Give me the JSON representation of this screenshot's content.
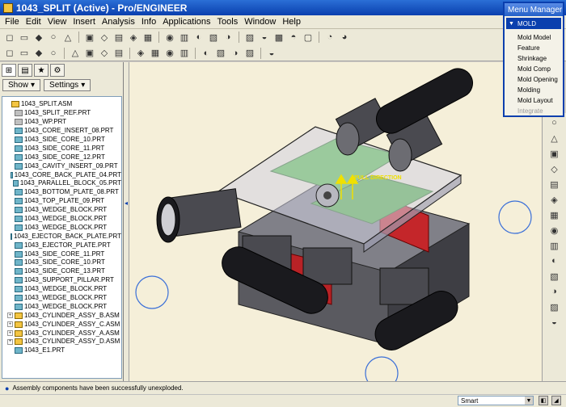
{
  "window": {
    "title": "1043_SPLIT (Active) - Pro/ENGINEER"
  },
  "menubar": [
    "File",
    "Edit",
    "View",
    "Insert",
    "Analysis",
    "Info",
    "Applications",
    "Tools",
    "Window",
    "Help"
  ],
  "panel": {
    "show_label": "Show",
    "settings_label": "Settings"
  },
  "tree": [
    {
      "label": "1043_SPLIT.ASM",
      "type": "asm",
      "indent": 0,
      "expander": ""
    },
    {
      "label": "1043_SPLIT_REF.PRT",
      "type": "ref",
      "indent": 1,
      "expander": ""
    },
    {
      "label": "1043_WP.PRT",
      "type": "ref",
      "indent": 1,
      "expander": ""
    },
    {
      "label": "1043_CORE_INSERT_08.PRT",
      "type": "prt",
      "indent": 1,
      "expander": ""
    },
    {
      "label": "1043_SIDE_CORE_10.PRT",
      "type": "prt",
      "indent": 1,
      "expander": ""
    },
    {
      "label": "1043_SIDE_CORE_11.PRT",
      "type": "prt",
      "indent": 1,
      "expander": ""
    },
    {
      "label": "1043_SIDE_CORE_12.PRT",
      "type": "prt",
      "indent": 1,
      "expander": ""
    },
    {
      "label": "1043_CAVITY_INSERT_09.PRT",
      "type": "prt",
      "indent": 1,
      "expander": ""
    },
    {
      "label": "1043_CORE_BACK_PLATE_04.PRT",
      "type": "prt",
      "indent": 1,
      "expander": ""
    },
    {
      "label": "1043_PARALLEL_BLOCK_05.PRT",
      "type": "prt",
      "indent": 1,
      "expander": ""
    },
    {
      "label": "1043_BOTTOM_PLATE_08.PRT",
      "type": "prt",
      "indent": 1,
      "expander": ""
    },
    {
      "label": "1043_TOP_PLATE_09.PRT",
      "type": "prt",
      "indent": 1,
      "expander": ""
    },
    {
      "label": "1043_WEDGE_BLOCK.PRT",
      "type": "prt",
      "indent": 1,
      "expander": ""
    },
    {
      "label": "1043_WEDGE_BLOCK.PRT",
      "type": "prt",
      "indent": 1,
      "expander": ""
    },
    {
      "label": "1043_WEDGE_BLOCK.PRT",
      "type": "prt",
      "indent": 1,
      "expander": ""
    },
    {
      "label": "1043_EJECTOR_BACK_PLATE.PRT",
      "type": "prt",
      "indent": 1,
      "expander": ""
    },
    {
      "label": "1043_EJECTOR_PLATE.PRT",
      "type": "prt",
      "indent": 1,
      "expander": ""
    },
    {
      "label": "1043_SIDE_CORE_11.PRT",
      "type": "prt",
      "indent": 1,
      "expander": ""
    },
    {
      "label": "1043_SIDE_CORE_10.PRT",
      "type": "prt",
      "indent": 1,
      "expander": ""
    },
    {
      "label": "1043_SIDE_CORE_13.PRT",
      "type": "prt",
      "indent": 1,
      "expander": ""
    },
    {
      "label": "1043_SUPPORT_PILLAR.PRT",
      "type": "prt",
      "indent": 1,
      "expander": ""
    },
    {
      "label": "1043_WEDGE_BLOCK.PRT",
      "type": "prt",
      "indent": 1,
      "expander": ""
    },
    {
      "label": "1043_WEDGE_BLOCK.PRT",
      "type": "prt",
      "indent": 1,
      "expander": ""
    },
    {
      "label": "1043_WEDGE_BLOCK.PRT",
      "type": "prt",
      "indent": 1,
      "expander": ""
    },
    {
      "label": "1043_CYLINDER_ASSY_B.ASM",
      "type": "asm",
      "indent": 1,
      "expander": "+"
    },
    {
      "label": "1043_CYLINDER_ASSY_C.ASM",
      "type": "asm",
      "indent": 1,
      "expander": "+"
    },
    {
      "label": "1043_CYLINDER_ASSY_A.ASM",
      "type": "asm",
      "indent": 1,
      "expander": "+"
    },
    {
      "label": "1043_CYLINDER_ASSY_D.ASM",
      "type": "asm",
      "indent": 1,
      "expander": "+"
    },
    {
      "label": "1043_E1.PRT",
      "type": "prt",
      "indent": 1,
      "expander": ""
    }
  ],
  "viewport": {
    "annotation": "PULL DIRECTION"
  },
  "menu_manager": {
    "title": "Menu Manager",
    "header": "MOLD",
    "items": [
      {
        "label": "Mold Model",
        "enabled": true
      },
      {
        "label": "Feature",
        "enabled": true
      },
      {
        "label": "Shrinkage",
        "enabled": true
      },
      {
        "label": "Mold Comp",
        "enabled": true
      },
      {
        "label": "Mold Opening",
        "enabled": true
      },
      {
        "label": "Molding",
        "enabled": true
      },
      {
        "label": "Mold Layout",
        "enabled": true
      },
      {
        "label": "Integrate",
        "enabled": false
      }
    ]
  },
  "status": {
    "message": "Assembly components have been successfully unexploded."
  },
  "filter": {
    "value": "Smart"
  },
  "icons": {
    "toolbar1": [
      "new-icon",
      "open-icon",
      "save-icon",
      "print-icon",
      "email-icon",
      "undo-icon",
      "redo-icon",
      "cut-icon",
      "copy-icon",
      "paste-icon",
      "regenerate-icon",
      "find-icon",
      "select-box-icon",
      "repaint-icon",
      "spin-center-icon",
      "zoom-in-icon",
      "zoom-out-icon",
      "refit-icon",
      "reorient-icon",
      "saved-views-icon",
      "layers-icon",
      "view-manager-icon"
    ],
    "toolbar2": [
      "datum-plane-icon",
      "datum-axis-icon",
      "datum-point-icon",
      "csys-icon",
      "wireframe-icon",
      "hidden-line-icon",
      "no-hidden-icon",
      "shading-icon",
      "mold-volume-icon",
      "parting-surface-icon",
      "split-icon",
      "ref-model-icon",
      "workpiece-icon",
      "cavity-icon",
      "sketch-icon",
      "runner-icon",
      "waterline-icon"
    ],
    "right": [
      "datum-icon",
      "surface-icon",
      "sketch-icon",
      "volume-icon",
      "split-volume-icon",
      "extract-icon",
      "mold-open-icon",
      "curve-icon",
      "plane-icon",
      "line-icon",
      "spline-icon",
      "point-icon",
      "axis-icon",
      "csys-small-icon"
    ]
  },
  "colors": {
    "title_bar": "#0a3fae",
    "viewport_bg": "#f5efd9",
    "annotation": "#f0e000"
  }
}
